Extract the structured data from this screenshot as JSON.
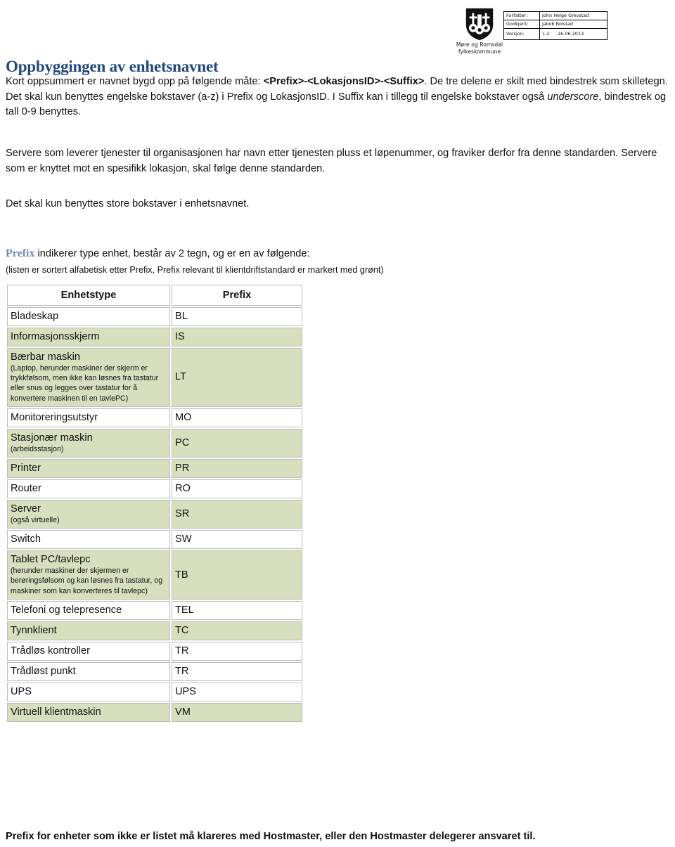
{
  "header": {
    "logo_line1": "Møre og Romsdal",
    "logo_line2": "fylkeskommune",
    "meta": {
      "author_label": "Forfatter:",
      "author_value": "John Helge Grevstad",
      "approved_label": "Godkjent:",
      "approved_value": "Jakob Bolstad",
      "version_label": "Versjon:",
      "version_number": "1.2",
      "version_date": "26.06.2013"
    }
  },
  "title": "Oppbyggingen av enhetsnavnet",
  "paragraphs": {
    "intro_part1": "Kort oppsummert er navnet bygd opp på følgende måte: ",
    "intro_pattern": "<Prefix>-<LokasjonsID>-<Suffix>",
    "intro_part2": ". De tre delene er skilt med bindestrek som skilletegn. Det skal kun benyttes engelske bokstaver (a-z) i Prefix og LokasjonsID. I Suffix kan i tillegg til engelske bokstaver også ",
    "intro_italic": "underscore",
    "intro_part3": ", bindestrek og tall 0-9 benyttes.",
    "server": "Servere som leverer tjenester til organisasjonen har navn etter tjenesten pluss et løpenummer, og fraviker derfor fra denne standarden. Servere som er knyttet mot en spesifikk lokasjon, skal følge denne standarden.",
    "uppercase": "Det skal kun benyttes store bokstaver i enhetsnavnet.",
    "prefix_keyword": "Prefix",
    "prefix_lead_rest": " indikerer type enhet, består av 2 tegn, og er en av følgende:",
    "prefix_sub": "(listen er sortert alfabetisk etter Prefix, Prefix relevant til klientdriftstandard er markert med grønt)"
  },
  "table": {
    "headers": [
      "Enhetstype",
      "Prefix"
    ],
    "rows": [
      {
        "type": "Bladeskap",
        "sub": "",
        "prefix": "BL",
        "highlight": false
      },
      {
        "type": "Informasjonsskjerm",
        "sub": "",
        "prefix": "IS",
        "highlight": true
      },
      {
        "type": "Bærbar maskin",
        "sub": "(Laptop, herunder maskiner der skjerm er trykkfølsom, men ikke kan løsnes fra tastatur eller snus og legges over tastatur for å konvertere maskinen til en tavlePC)",
        "prefix": "LT",
        "highlight": true
      },
      {
        "type": "Monitoreringsutstyr",
        "sub": "",
        "prefix": "MO",
        "highlight": false
      },
      {
        "type": "Stasjonær maskin",
        "sub": "(arbeidsstasjon)",
        "prefix": "PC",
        "highlight": true
      },
      {
        "type": "Printer",
        "sub": "",
        "prefix": "PR",
        "highlight": true
      },
      {
        "type": "Router",
        "sub": "",
        "prefix": "RO",
        "highlight": false
      },
      {
        "type": "Server",
        "sub": "(også virtuelle)",
        "prefix": "SR",
        "highlight": true
      },
      {
        "type": "Switch",
        "sub": "",
        "prefix": "SW",
        "highlight": false
      },
      {
        "type": "Tablet PC/tavlepc",
        "sub": "(herunder maskiner der skjermen er berøringsfølsom og  kan løsnes fra tastatur, og maskiner som kan konverteres til tavlepc)",
        "prefix": "TB",
        "highlight": true
      },
      {
        "type": "Telefoni og telepresence",
        "sub": "",
        "prefix": "TEL",
        "highlight": false
      },
      {
        "type": "Tynnklient",
        "sub": "",
        "prefix": "TC",
        "highlight": true
      },
      {
        "type": "Trådløs kontroller",
        "sub": "",
        "prefix": "TR",
        "highlight": false
      },
      {
        "type": "Trådløst punkt",
        "sub": "",
        "prefix": "TR",
        "highlight": false
      },
      {
        "type": "UPS",
        "sub": "",
        "prefix": "UPS",
        "highlight": false
      },
      {
        "type": "Virtuell klientmaskin",
        "sub": "",
        "prefix": "VM",
        "highlight": true
      }
    ]
  },
  "footer": "Prefix for enheter som ikke er listet må klareres med Hostmaster, eller den Hostmaster delegerer ansvaret til.",
  "colors": {
    "title_blue": "#22497c",
    "keyword_blue": "#6d8cb2",
    "row_green": "#d7dfbe",
    "cell_border": "#b9bdb5"
  }
}
